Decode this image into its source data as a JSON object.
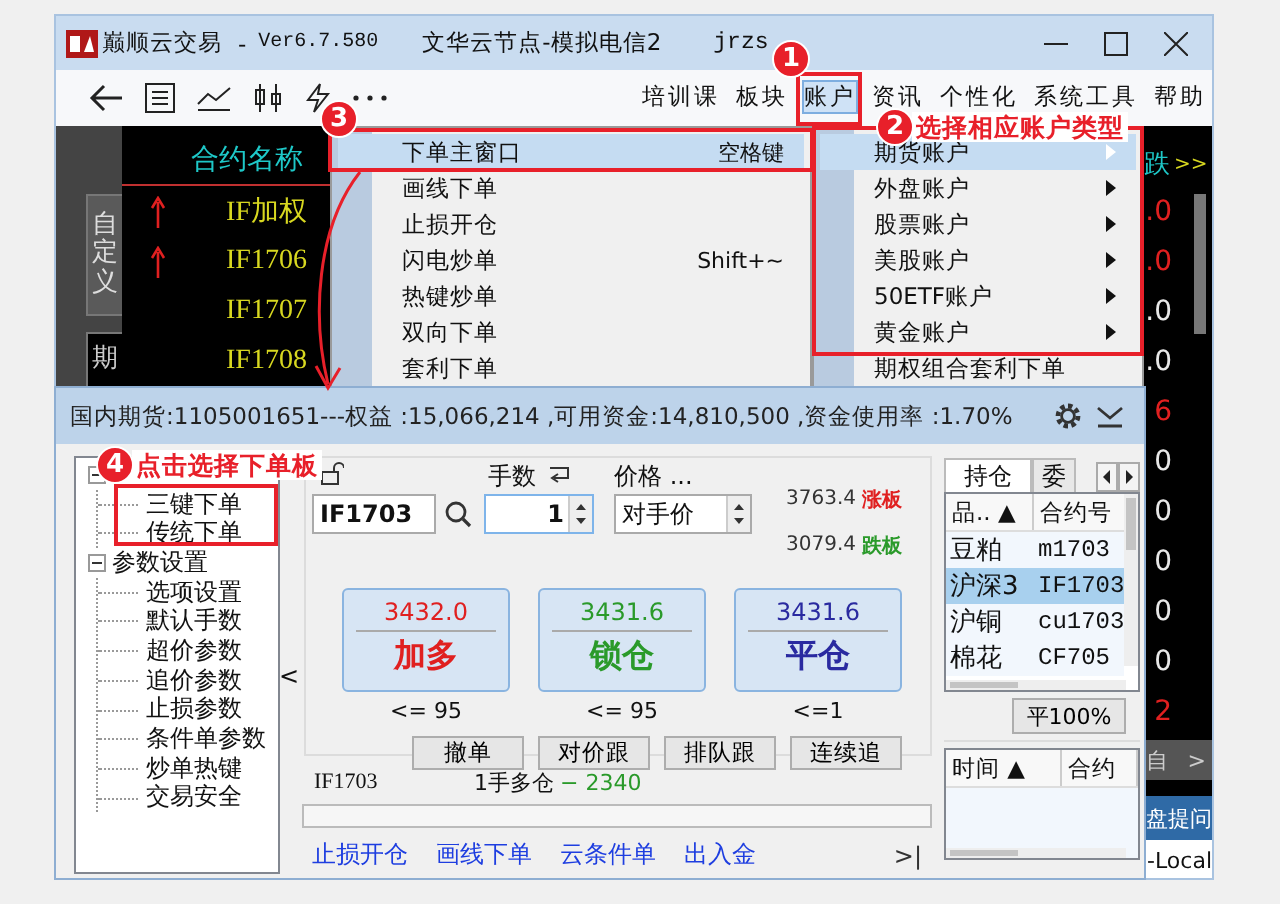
{
  "main_window": {
    "title": {
      "app": "巅顺云交易",
      "separator": "-",
      "version": "Ver6.7.580",
      "server": "文华云节点-模拟电信2",
      "user": "jrzs"
    },
    "menu": [
      {
        "label": "培训课",
        "selected": false
      },
      {
        "label": "板块",
        "selected": false
      },
      {
        "label": "账户",
        "selected": true
      },
      {
        "label": "资讯",
        "selected": false
      },
      {
        "label": "个性化",
        "selected": false
      },
      {
        "label": "系统工具",
        "selected": false
      },
      {
        "label": "帮助",
        "selected": false
      }
    ],
    "side_tabs": [
      {
        "label": "自定义",
        "selected": false
      },
      {
        "label": "期",
        "selected": true
      }
    ],
    "quotes": {
      "header": "合约名称",
      "rows": [
        {
          "name": "IF加权",
          "up": true
        },
        {
          "name": "IF1706",
          "up": true
        },
        {
          "name": "IF1707",
          "up": false
        },
        {
          "name": "IF1708",
          "up": false
        }
      ]
    },
    "right_column": {
      "header": "跌",
      "more": ">>",
      "values": [
        {
          "text": ".0",
          "color": "#e02020"
        },
        {
          "text": ".0",
          "color": "#e02020"
        },
        {
          "text": ".0",
          "color": "#e8e8e8"
        },
        {
          "text": ".0",
          "color": "#e8e8e8"
        },
        {
          "text": "6",
          "color": "#e02020"
        },
        {
          "text": "0",
          "color": "#e8e8e8"
        },
        {
          "text": "0",
          "color": "#e8e8e8"
        },
        {
          "text": "0",
          "color": "#e8e8e8"
        },
        {
          "text": "0",
          "color": "#e8e8e8"
        },
        {
          "text": "0",
          "color": "#e8e8e8"
        },
        {
          "text": "2",
          "color": "#e02020"
        }
      ],
      "tab": "自",
      "tab_arrow": ">",
      "ask_button": "盘提问",
      "local_label": "-Local"
    }
  },
  "account_menu": {
    "items": [
      {
        "label": "期货账户",
        "selected": true,
        "submenu": true
      },
      {
        "label": "外盘账户",
        "selected": false,
        "submenu": true
      },
      {
        "label": "股票账户",
        "selected": false,
        "submenu": true
      },
      {
        "label": "美股账户",
        "selected": false,
        "submenu": true
      },
      {
        "label": "50ETF账户",
        "selected": false,
        "submenu": true
      },
      {
        "label": "黄金账户",
        "selected": false,
        "submenu": true
      },
      {
        "label": "期权组合套利下单",
        "selected": false,
        "submenu": false
      }
    ]
  },
  "order_submenu": {
    "items": [
      {
        "label": "下单主窗口",
        "shortcut": "空格键",
        "selected": true
      },
      {
        "label": "画线下单",
        "selected": false
      },
      {
        "label": "止损开仓",
        "selected": false
      },
      {
        "label": "闪电炒单",
        "shortcut": "Shift+~",
        "selected": false
      },
      {
        "label": "热键炒单",
        "selected": false
      },
      {
        "label": "双向下单",
        "selected": false
      },
      {
        "label": "套利下单",
        "selected": false
      }
    ]
  },
  "annotations": [
    {
      "number": "1"
    },
    {
      "number": "3"
    },
    {
      "number": "2",
      "text": "选择相应账户类型"
    },
    {
      "number": "4",
      "text": "点击选择下单板"
    }
  ],
  "order_dialog": {
    "title": "国内期货:1105001651---权益 :15,066,214 ,可用资金:14,810,500 ,资金使用率 :1.70%",
    "tree": [
      {
        "expanded": true,
        "children": [
          {
            "label": "三键下单"
          },
          {
            "label": "传统下单"
          }
        ]
      },
      {
        "label": "参数设置",
        "expanded": true,
        "children": [
          {
            "label": "选项设置"
          },
          {
            "label": "默认手数"
          },
          {
            "label": "超价参数"
          },
          {
            "label": "追价参数"
          },
          {
            "label": "止损参数"
          },
          {
            "label": "条件单参数"
          },
          {
            "label": "炒单热键"
          },
          {
            "label": "交易安全"
          }
        ]
      }
    ],
    "collapse": "<",
    "symbol": "IF1703",
    "qty_label": "手数",
    "qty": "1",
    "price_label": "价格 ...",
    "price_type": "对手价",
    "limit_up": {
      "value": "3763.4",
      "label": "涨板"
    },
    "limit_down": {
      "value": "3079.4",
      "label": "跌板"
    },
    "actions": [
      {
        "price": "3432.0",
        "label": "加多",
        "limit": "<= 95",
        "color": "#e02020"
      },
      {
        "price": "3431.6",
        "label": "锁仓",
        "limit": "<= 95",
        "color": "#2a9a2a"
      },
      {
        "price": "3431.6",
        "label": "平仓",
        "limit": "<=1",
        "color": "#2a2aa0"
      }
    ],
    "buttons": [
      "撤单",
      "对价跟",
      "排队跟",
      "连续追"
    ],
    "position": {
      "symbol": "IF1703",
      "text": "1手多仓",
      "change": "− 2340"
    },
    "progress": {
      "level": 0
    },
    "links": [
      "止损开仓",
      "画线下单",
      "云条件单",
      "出入金"
    ],
    "end_link": ">|",
    "tabs": [
      {
        "label": "持仓",
        "selected": true
      },
      {
        "label": "委",
        "selected": false
      }
    ],
    "positions": {
      "columns": [
        "品.. ▲",
        "合约号"
      ],
      "rows": [
        {
          "cells": [
            "豆粕",
            "m1703"
          ],
          "selected": false
        },
        {
          "cells": [
            "沪深3",
            "IF1703"
          ],
          "selected": true
        },
        {
          "cells": [
            "沪铜",
            "cu1703"
          ],
          "selected": false
        },
        {
          "cells": [
            "棉花",
            "CF705"
          ],
          "selected": false
        }
      ]
    },
    "close_all": "平100%",
    "orders": {
      "columns": [
        "时间 ▲",
        "合约"
      ]
    }
  }
}
